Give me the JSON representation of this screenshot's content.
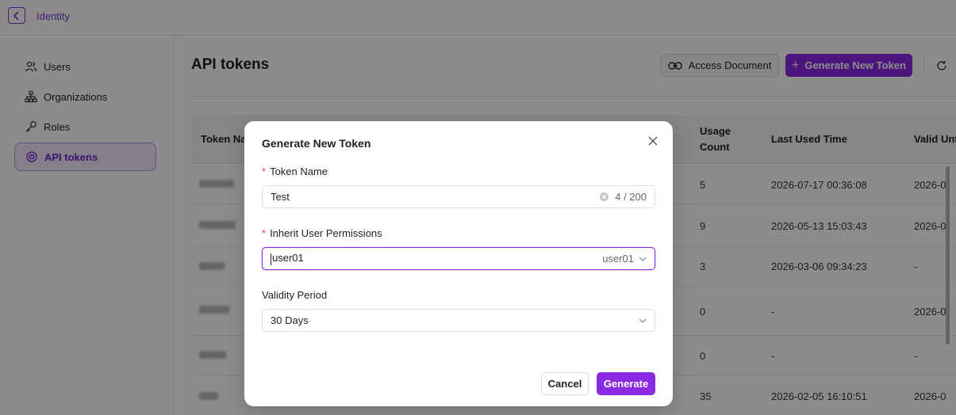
{
  "header": {
    "back_label": "Identity"
  },
  "sidebar": {
    "items": [
      {
        "label": "Users",
        "icon": "users-icon"
      },
      {
        "label": "Organizations",
        "icon": "org-chart-icon"
      },
      {
        "label": "Roles",
        "icon": "key-icon"
      },
      {
        "label": "API tokens",
        "icon": "api-token-icon",
        "active": true
      }
    ]
  },
  "main": {
    "title": "API tokens",
    "access_document_label": "Access Document",
    "generate_new_token_label": "Generate New Token",
    "table": {
      "columns": [
        "Token Name",
        "Usage Count",
        "Last Used Time",
        "Valid Until"
      ],
      "rows": [
        {
          "usage": "5",
          "last_used": "2026-07-17 00:36:08",
          "valid": "2026-0"
        },
        {
          "usage": "9",
          "last_used": "2026-05-13 15:03:43",
          "valid": "2026-0"
        },
        {
          "usage": "3",
          "last_used": "2026-03-06 09:34:23",
          "valid": "-"
        },
        {
          "usage": "0",
          "last_used": "-",
          "valid": "2026-0"
        },
        {
          "usage": "0",
          "last_used": "-",
          "valid": "-"
        },
        {
          "usage": "35",
          "last_used": "2026-02-05 16:10:51",
          "valid": "2026-0"
        }
      ]
    }
  },
  "modal": {
    "title": "Generate New Token",
    "token_name_label": "Token Name",
    "token_name_value": "Test",
    "token_name_counter": "4 / 200",
    "inherit_label": "Inherit User Permissions",
    "inherit_input": "user01",
    "inherit_selected": "user01",
    "validity_label": "Validity Period",
    "validity_value": "30 Days",
    "cancel_label": "Cancel",
    "generate_label": "Generate"
  },
  "colors": {
    "accent": "#8a2be2",
    "required": "#e5484d"
  }
}
